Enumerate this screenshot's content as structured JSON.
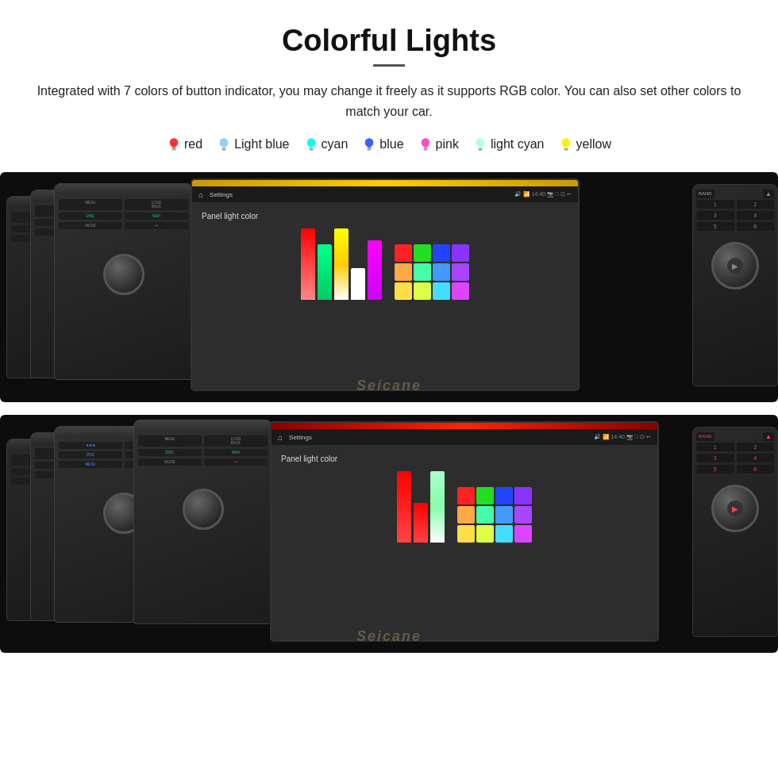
{
  "header": {
    "title": "Colorful Lights",
    "description": "Integrated with 7 colors of button indicator, you may change it freely as it supports RGB color. You can also set other colors to match your car."
  },
  "colors": [
    {
      "name": "red",
      "hex": "#ff2222",
      "bulb_color": "#ff2222"
    },
    {
      "name": "Light blue",
      "hex": "#88ccff",
      "bulb_color": "#88ccff"
    },
    {
      "name": "cyan",
      "hex": "#00ffee",
      "bulb_color": "#00ffee"
    },
    {
      "name": "blue",
      "hex": "#3355ff",
      "bulb_color": "#3355ff"
    },
    {
      "name": "pink",
      "hex": "#ff44cc",
      "bulb_color": "#ff44cc"
    },
    {
      "name": "light cyan",
      "hex": "#aaffee",
      "bulb_color": "#aaffee"
    },
    {
      "name": "yellow",
      "hex": "#ffee00",
      "bulb_color": "#ffee00"
    }
  ],
  "screen1": {
    "header_text": "Settings",
    "panel_light_label": "Panel light color",
    "bars": [
      {
        "color": "#ff0000",
        "height": 70
      },
      {
        "color": "#00ff00",
        "height": 50
      },
      {
        "color": "#ffff00",
        "height": 80
      },
      {
        "color": "#ffffff",
        "height": 30
      },
      {
        "color": "#ff00ff",
        "height": 60
      }
    ],
    "swatches": [
      "#ff2222",
      "#22ff22",
      "#2255ff",
      "#8844ff",
      "#ff8844",
      "#44ff88",
      "#4488ff",
      "#aa44ff",
      "#ffcc44",
      "#ccff44",
      "#44ccff",
      "#cc44ff",
      "#ffffff",
      "#aaaaff",
      "#ffaaaa",
      "#aaffaa"
    ]
  },
  "screen2": {
    "header_text": "Settings",
    "panel_light_label": "Panel light color",
    "bars": [
      {
        "color": "#ff0000",
        "height": 70
      },
      {
        "color": "#ff0000",
        "height": 40
      },
      {
        "color": "#aaffaa",
        "height": 80
      }
    ],
    "swatches": [
      "#ff2222",
      "#22ff22",
      "#2255ff",
      "#8844ff",
      "#ff8844",
      "#44ff88",
      "#4488ff",
      "#aa44ff",
      "#ffcc44",
      "#ccff44",
      "#44ccff",
      "#cc44ff",
      "#ffffff",
      "#aaaaff",
      "#ffaaaa",
      "#aaffaa"
    ]
  },
  "watermark": "Seicane",
  "panel_buttons_set1": {
    "top_left": [
      [
        "MENU",
        "LOUD"
      ],
      [
        "",
        "BACK"
      ],
      [
        "DISC",
        "NAVI"
      ],
      [
        "MODE",
        ""
      ]
    ]
  }
}
